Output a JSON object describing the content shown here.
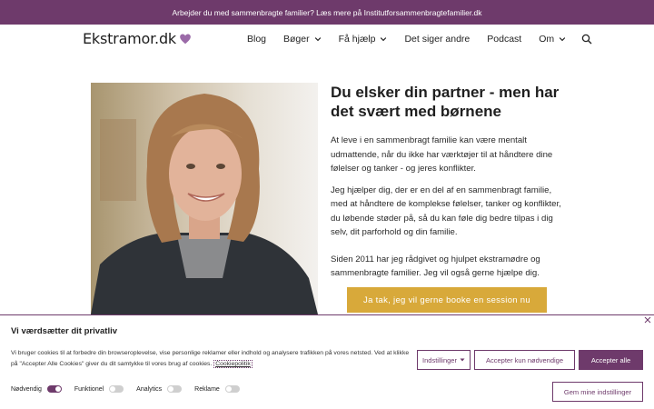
{
  "topbar": {
    "text": "Arbejder du med sammenbragte familier? Læs mere på Institutforsammenbragtefamilier.dk"
  },
  "header": {
    "logo_text": "Ekstramor.dk",
    "nav": [
      {
        "label": "Blog"
      },
      {
        "label": "Bøger"
      },
      {
        "label": "Få hjælp"
      },
      {
        "label": "Det siger andre"
      },
      {
        "label": "Podcast"
      },
      {
        "label": "Om"
      }
    ]
  },
  "hero": {
    "title": "Du elsker din partner - men har det svært med børnene",
    "paragraphs": [
      "At leve i en sammenbragt familie kan være mentalt udmattende, når du ikke har værktøjer til at håndtere dine følelser og tanker - og jeres konflikter.",
      "Jeg hjælper dig, der er en del af en sammenbragt familie, med at håndtere de komplekse følelser, tanker og konflikter, du løbende støder på, så du kan føle dig bedre tilpas i dig selv, dit parforhold og din familie.",
      "Siden 2011 har jeg rådgivet og hjulpet ekstramødre og sammenbragte familier. Jeg vil også gerne hjælpe dig."
    ],
    "cta": "Ja tak, jeg vil gerne booke en session nu"
  },
  "cookie": {
    "title": "Vi værdsætter dit privatliv",
    "description": "Vi bruger cookies til at forbedre din browseroplevelse, vise personlige reklamer eller indhold og analysere trafikken på vores netsted. Ved at klikke på \"Accepter Alle Cookies\" giver du dit samtykke til vores brug af cookies.",
    "policy_link": "Cookiepolitik",
    "buttons": {
      "settings": "Indstillinger",
      "necessary": "Accepter kun nødvendige",
      "accept_all": "Accepter alle",
      "save": "Gem mine indstillinger"
    },
    "toggles": [
      {
        "label": "Nødvendig",
        "on": true
      },
      {
        "label": "Funktionel",
        "on": false
      },
      {
        "label": "Analytics",
        "on": false
      },
      {
        "label": "Reklame",
        "on": false
      }
    ]
  },
  "colors": {
    "brand": "#6e3a6b",
    "cta": "#d8a93a",
    "heart": "#9b6aa8"
  }
}
